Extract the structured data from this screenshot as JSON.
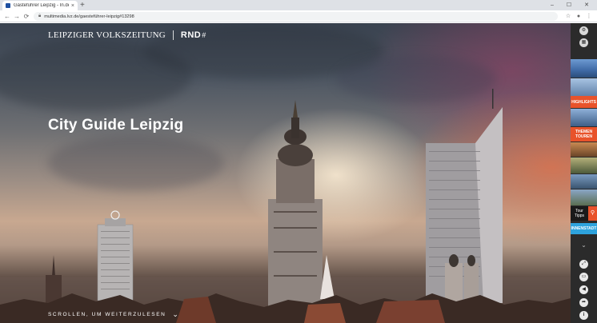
{
  "browser": {
    "tab_title": "Gästeführer Leipzig - In.de",
    "tab_close": "×",
    "new_tab": "+",
    "url": "multimedia.lvz.de/gaesteführer-leipzig#13298",
    "win_min": "–",
    "win_max": "☐",
    "win_close": "✕",
    "back": "←",
    "forward": "→",
    "reload": "⟳",
    "star": "☆",
    "profile": "●",
    "menu": "⋮"
  },
  "header": {
    "logo_lvz": "LEIPZIGER VOLKSZEITUNG",
    "logo_rnd": "RND",
    "logo_hash": "#"
  },
  "hero": {
    "title": "City Guide Leipzig",
    "scroll_hint": "SCROLLEN, UM WEITERZULESEN",
    "scroll_chevron": "⌄"
  },
  "sidebar": {
    "top_icons": [
      "⚙",
      "▦"
    ],
    "items": [
      {
        "label": "HIGHLIGHTS",
        "color": "#e8532b"
      },
      {
        "label": "THEMEN TOUREN",
        "color": "#e8532b"
      },
      {
        "label": "Tour Tipps",
        "color": "#1a1a1a"
      },
      {
        "label": "INNENSTADT",
        "color": "#2ea3dd"
      }
    ],
    "search_icon": "⚲",
    "chevron": "⌄",
    "tools": [
      "⤢",
      "▭",
      "◀",
      "➦",
      "i"
    ]
  },
  "colors": {
    "accent_orange": "#e8532b",
    "accent_blue": "#2ea3dd",
    "sidebar_bg": "#2b2b2b"
  }
}
